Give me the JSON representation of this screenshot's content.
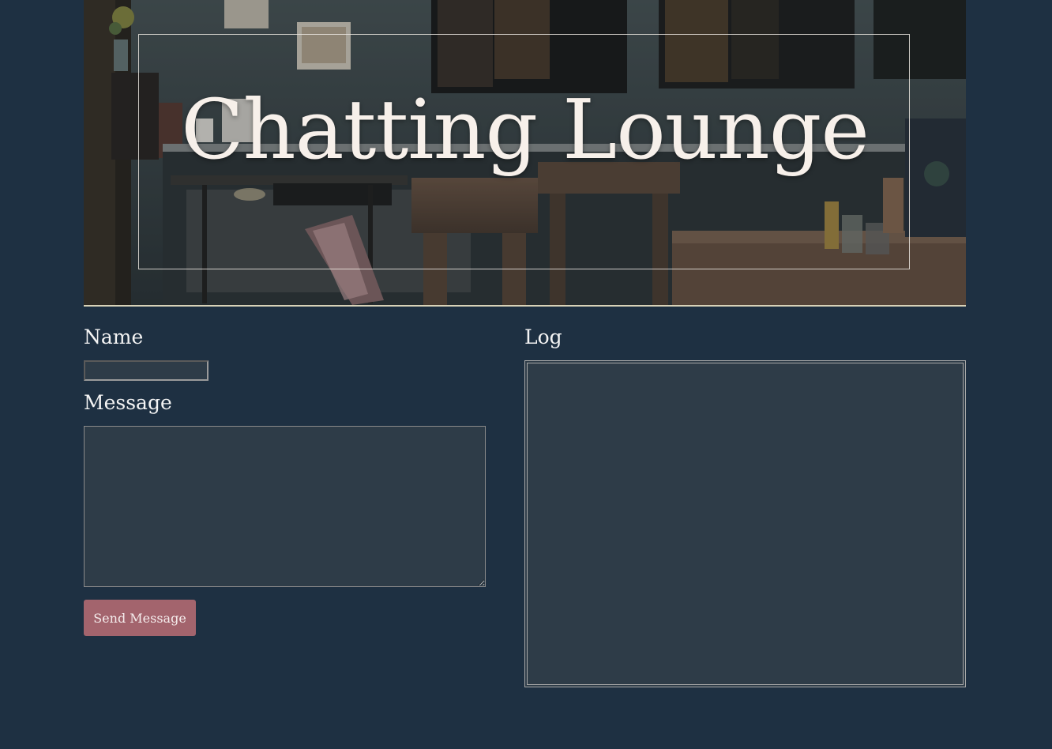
{
  "header": {
    "title": "Chatting Lounge"
  },
  "form": {
    "name_label": "Name",
    "name_value": "",
    "message_label": "Message",
    "message_value": "",
    "send_label": "Send Message"
  },
  "log": {
    "label": "Log",
    "entries": []
  },
  "colors": {
    "background": "#1e3042",
    "field_background": "#2e3c48",
    "button": "#a3646d",
    "title_text": "#f7f0ea",
    "divider": "#d8d2b8"
  }
}
